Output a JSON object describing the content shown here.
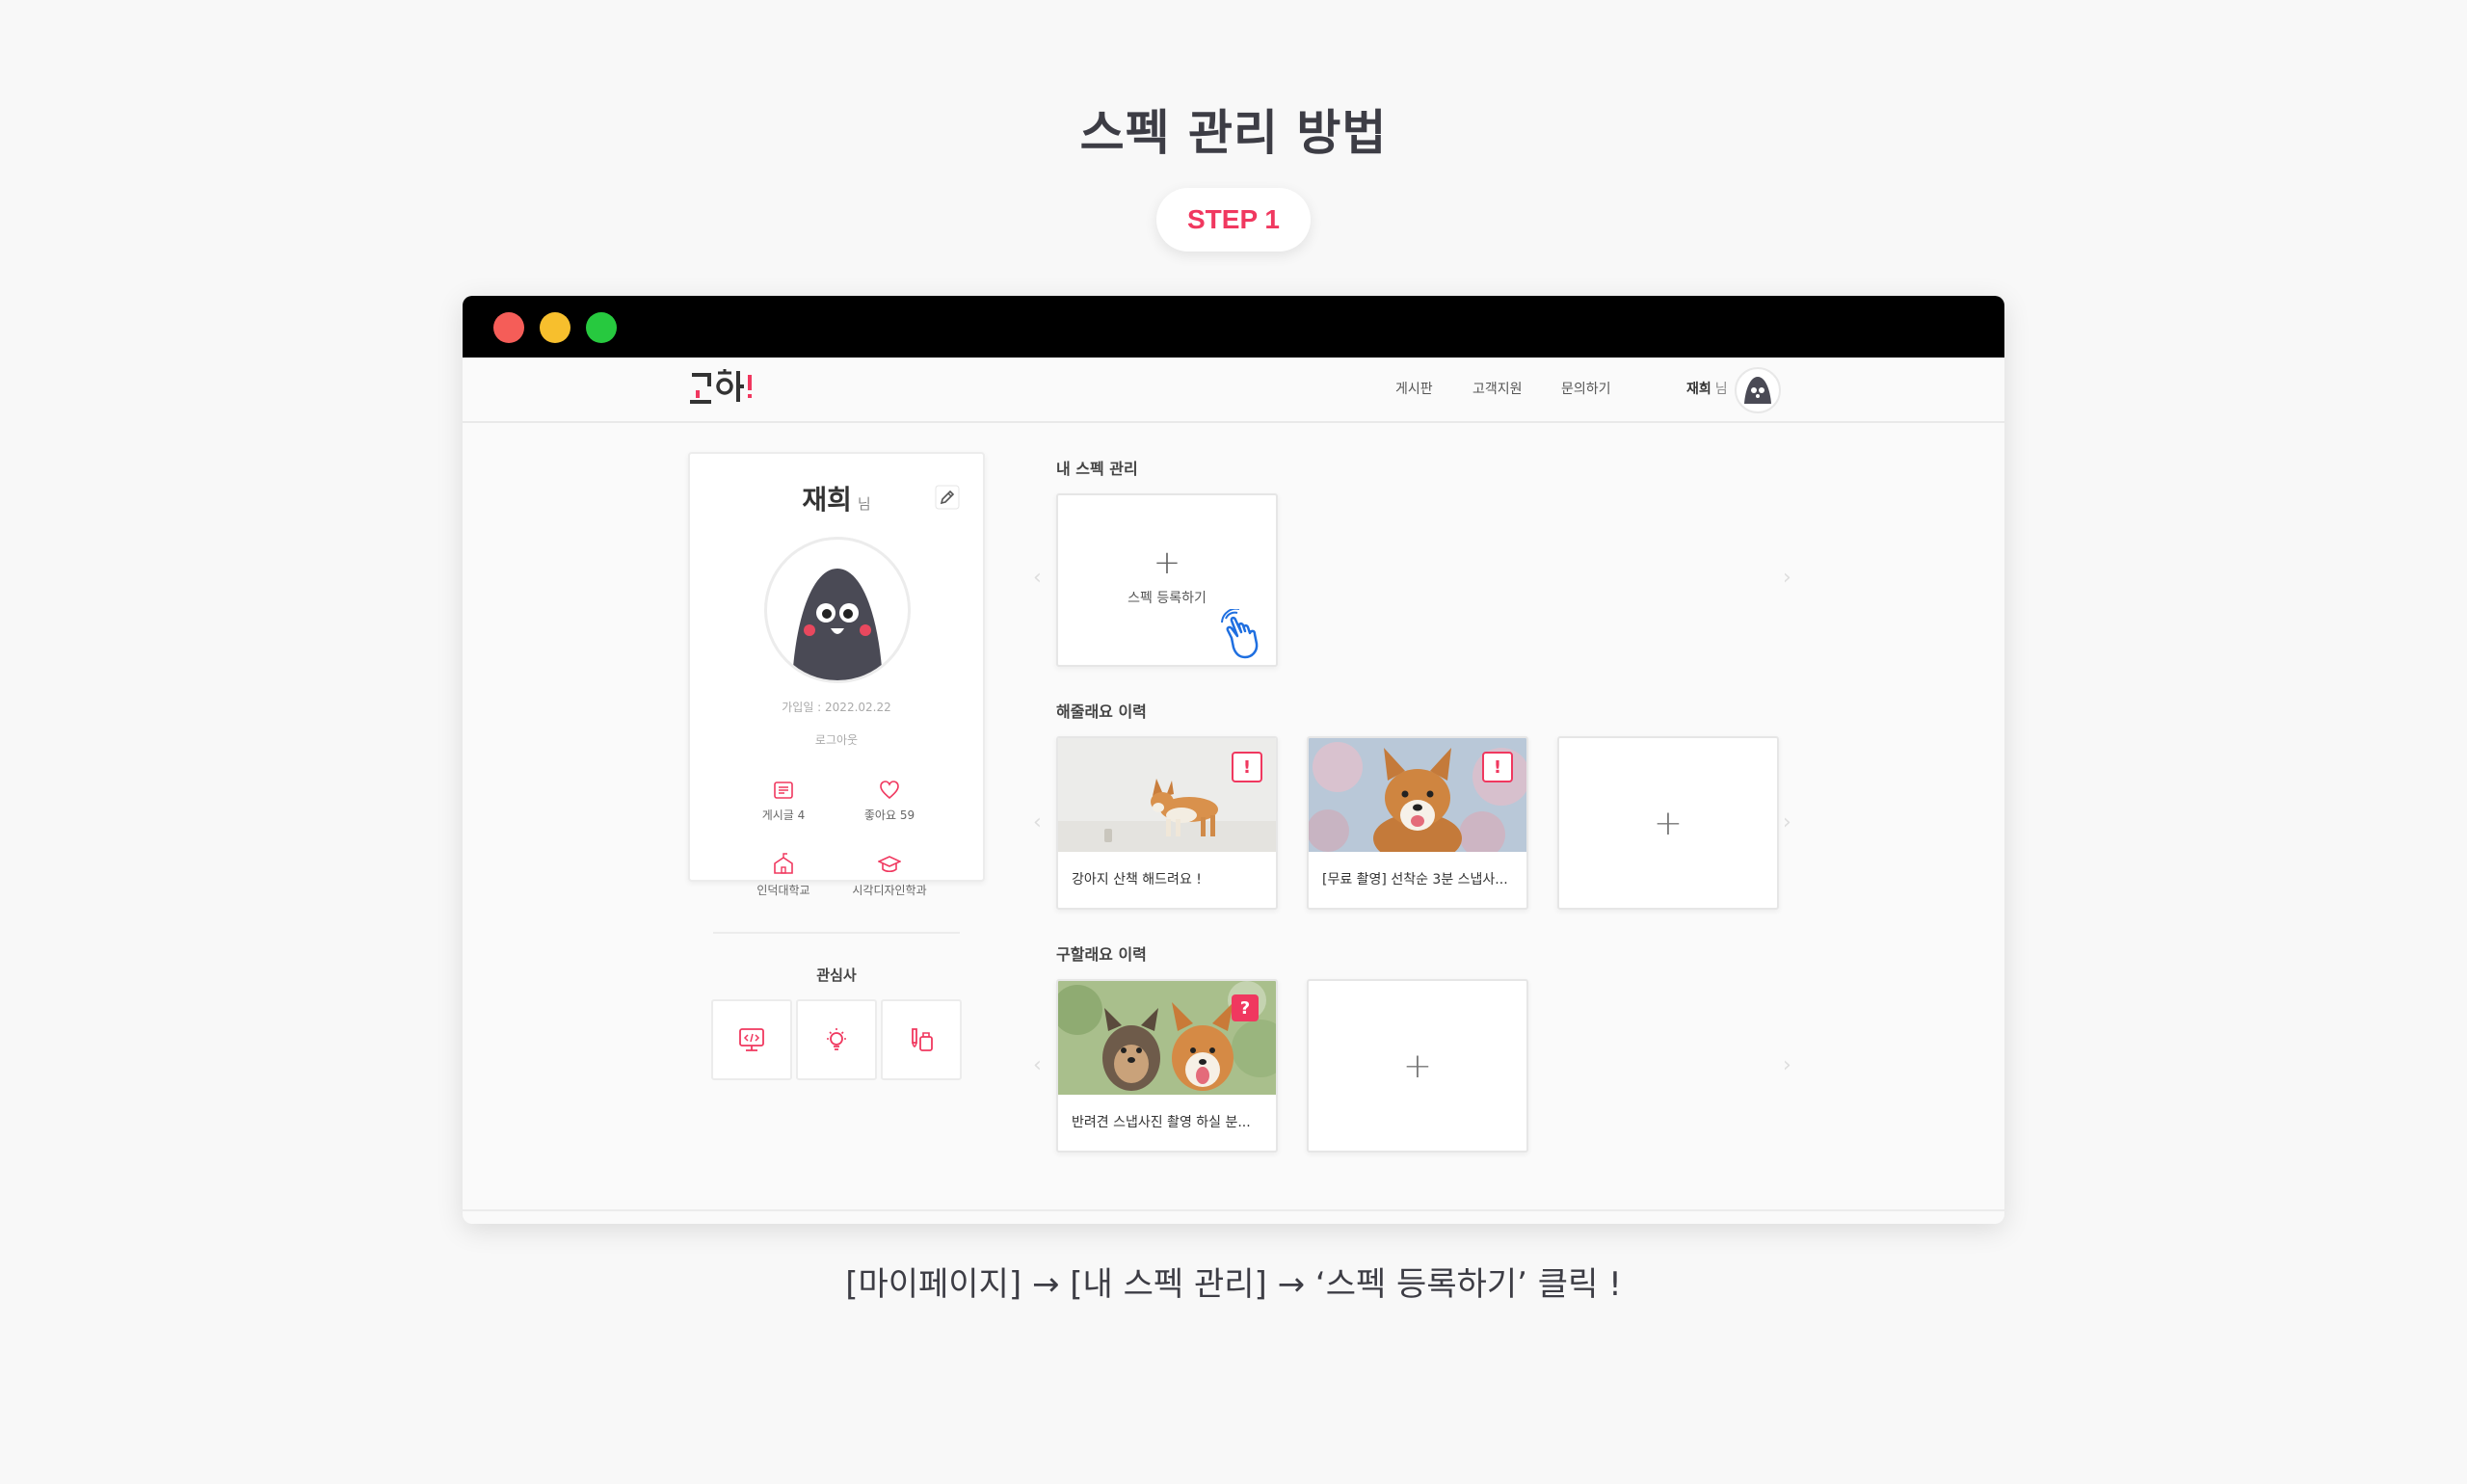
{
  "page": {
    "title": "스펙 관리 방법",
    "step_label": "STEP 1",
    "instruction": "[마이페이지] → [내 스펙 관리] → ‘스펙 등록하기’ 클릭 !"
  },
  "nav": {
    "items": [
      "게시판",
      "고객지원",
      "문의하기"
    ],
    "user_name": "재희",
    "user_suffix": "님"
  },
  "profile": {
    "name": "재희",
    "suffix": "님",
    "join_date": "가입일 : 2022.02.22",
    "logout": "로그아웃",
    "stats": [
      {
        "label": "게시글 4",
        "icon": "document-icon"
      },
      {
        "label": "좋아요 59",
        "icon": "heart-icon"
      },
      {
        "label": "인덕대학교",
        "icon": "school-icon"
      },
      {
        "label": "시각디자인학과",
        "icon": "graduation-cap-icon"
      }
    ],
    "interest_title": "관심사",
    "interests": [
      "monitor-code-icon",
      "lightbulb-icon",
      "brush-icon"
    ]
  },
  "sections": {
    "my_spec": {
      "title": "내 스펙 관리",
      "add_label": "스펙 등록하기"
    },
    "helped": {
      "title": "해줄래요 이력",
      "cards": [
        {
          "caption": "강아지 산책 해드려요 !",
          "badge": "!"
        },
        {
          "caption": "[무료 촬영] 선착순 3분 스냅사...",
          "badge": "!"
        }
      ]
    },
    "requested": {
      "title": "구할래요 이력",
      "cards": [
        {
          "caption": "반려견 스냅사진 촬영 하실 분...",
          "badge": "?"
        }
      ]
    }
  },
  "colors": {
    "accent": "#f0385f",
    "titlebar": "#000000",
    "dot_red": "#f55d58",
    "dot_yellow": "#f7bf2d",
    "dot_green": "#27c93f",
    "character": "#4a4a55"
  }
}
